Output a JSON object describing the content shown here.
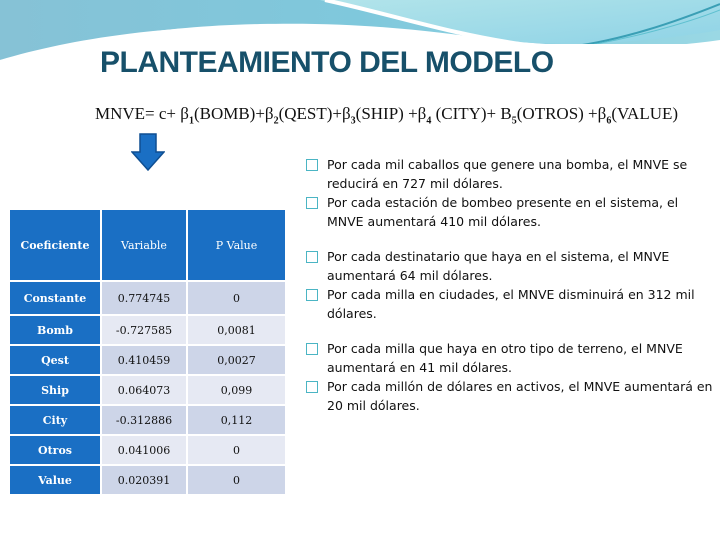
{
  "title": "PLANTEAMIENTO DEL MODELO",
  "formula": {
    "lhs": "MNVE= c+ ",
    "terms": [
      {
        "coef": "β",
        "sub": "1",
        "var": "(BOMB)+"
      },
      {
        "coef": "β",
        "sub": "2",
        "var": "(QEST)+"
      },
      {
        "coef": "β",
        "sub": "3",
        "var": "(SHIP) +"
      },
      {
        "coef": "β",
        "sub": "4",
        "var": " (CITY)+ "
      },
      {
        "coef": "B",
        "sub": "5",
        "var": "(OTROS) +"
      },
      {
        "coef": "β",
        "sub": "6",
        "var": "(VALUE)"
      }
    ]
  },
  "arrow_icon": "down-arrow-icon",
  "table": {
    "headers": [
      "Coeficiente",
      "Variable",
      "P Value"
    ],
    "rows": [
      {
        "name": "Constante",
        "value": "0.774745",
        "p": "0"
      },
      {
        "name": "Bomb",
        "value": "-0.727585",
        "p": "0,0081"
      },
      {
        "name": "Qest",
        "value": "0.410459",
        "p": "0,0027"
      },
      {
        "name": "Ship",
        "value": "0.064073",
        "p": "0,099"
      },
      {
        "name": "City",
        "value": "-0.312886",
        "p": "0,112"
      },
      {
        "name": "Otros",
        "value": "0.041006",
        "p": "0"
      },
      {
        "name": "Value",
        "value": "0.020391",
        "p": "0"
      }
    ]
  },
  "bullets": [
    "Por cada mil caballos que genere una bomba, el MNVE se reducirá en 727 mil dólares.",
    "Por cada estación de bombeo presente en el sistema, el MNVE aumentará 410 mil dólares.",
    "Por cada destinatario que haya en el sistema, el MNVE aumentará 64 mil dólares.",
    "Por cada milla en ciudades, el MNVE disminuirá en 312 mil dólares.",
    "Por cada milla que haya en otro tipo de terreno, el MNVE aumentará en 41 mil dólares.",
    "Por cada millón de dólares en activos, el MNVE aumentará en 20 mil dólares."
  ],
  "colors": {
    "title": "#17506a",
    "header_blue": "#1a6fc4",
    "row_dark": "#cdd5e8",
    "row_light": "#e6e9f3",
    "bullet_box": "#4bb5c4"
  }
}
